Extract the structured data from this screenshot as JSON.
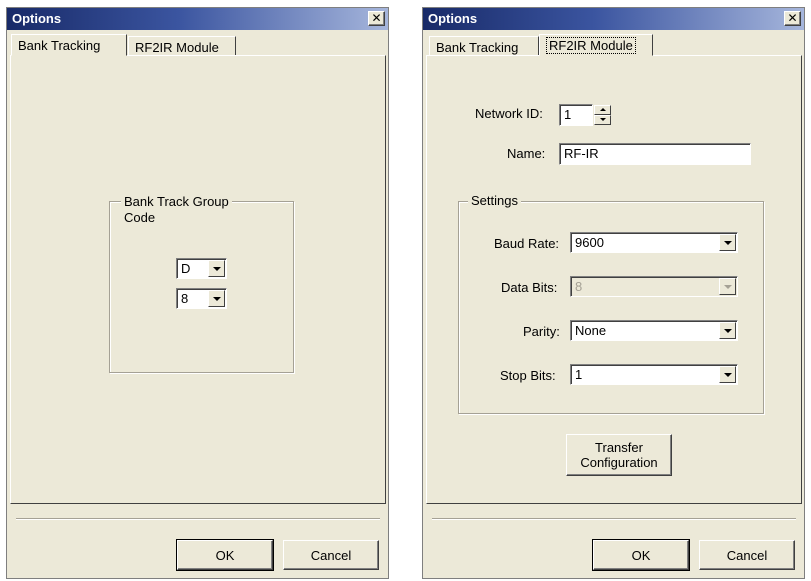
{
  "left_dialog": {
    "title": "Options",
    "close_glyph": "✕",
    "tabs": [
      "Bank Tracking",
      "RF2IR Module"
    ],
    "active_tab": "Bank Tracking",
    "group_title_line1": "Bank Track Group",
    "group_title_line2": "Code",
    "group_letter": "D",
    "group_number": "8",
    "ok_label": "OK",
    "cancel_label": "Cancel"
  },
  "right_dialog": {
    "title": "Options",
    "close_glyph": "✕",
    "tabs": [
      "Bank Tracking",
      "RF2IR Module"
    ],
    "active_tab": "RF2IR Module",
    "network_id_label": "Network ID:",
    "network_id_value": "1",
    "name_label": "Name:",
    "name_value": "RF-IR",
    "settings_title": "Settings",
    "baud_rate_label": "Baud Rate:",
    "baud_rate_value": "9600",
    "data_bits_label": "Data Bits:",
    "data_bits_value": "8",
    "parity_label": "Parity:",
    "parity_value": "None",
    "stop_bits_label": "Stop Bits:",
    "stop_bits_value": "1",
    "transfer_line1": "Transfer",
    "transfer_line2": "Configuration",
    "ok_label": "OK",
    "cancel_label": "Cancel"
  },
  "colors": {
    "dialog_face": "#ece9d8",
    "titlebar_start": "#182a68",
    "titlebar_end": "#a6b6dc"
  }
}
